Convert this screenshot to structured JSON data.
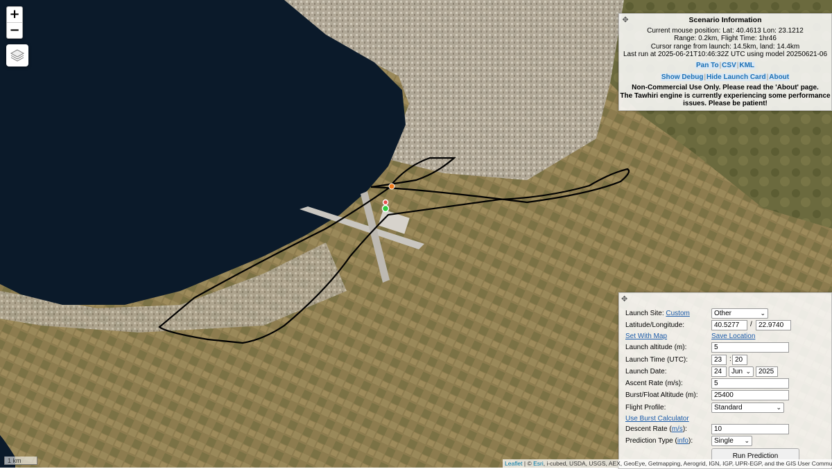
{
  "map": {
    "zoom_in": "+",
    "zoom_out": "−",
    "layers_icon": "layers-icon",
    "scale": "1 km",
    "attribution": {
      "leaflet": "Leaflet",
      "sep": " | © ",
      "esri": "Esri",
      "rest": ", i-cubed, USDA, USGS, AEX, GeoEye, Getmapping, Aerogrid, IGN, IGP, UPR-EGP, and the GIS User Community"
    },
    "colors": {
      "sea": "#0b1a2a",
      "land": "#8a7a4e",
      "urban": "#b8b0a2",
      "track": "#000000",
      "launch_marker": "#2ecc40",
      "burst_marker": "#e84a4a",
      "landing_marker": "#f07a1a"
    }
  },
  "scenario": {
    "title": "Scenario Information",
    "mouse_position": "Current mouse position: Lat: 40.4613 Lon: 23.1212",
    "range": "Range: 0.2km, Flight Time: 1hr46",
    "cursor_range": "Cursor range from launch: 14.5km, land: 14.4km",
    "last_run": "Last run at 2025-06-21T10:46:32Z UTC using model 20250621-06",
    "link_pan": "Pan To",
    "link_csv": "CSV",
    "link_kml": "KML",
    "link_debug": "Show Debug",
    "link_hide": "Hide Launch Card",
    "link_about": "About",
    "notice1": "Non-Commercial Use Only. Please read the 'About' page.",
    "notice2": "The Tawhiri engine is currently experiencing some performance",
    "notice3": "issues. Please be patient!"
  },
  "launch": {
    "site_label": "Launch Site:",
    "site_custom": "Custom",
    "site_value": "Other",
    "latlon_label": "Latitude/Longitude:",
    "lat": "40.5277",
    "lon": "22.9740",
    "slash": "/",
    "set_with_map": "Set With Map",
    "save_location": "Save Location",
    "alt_label": "Launch altitude (m):",
    "alt_value": "5",
    "time_label": "Launch Time (UTC):",
    "hour": "23",
    "colon": ":",
    "minute": "20",
    "date_label": "Launch Date:",
    "day": "24",
    "month": "Jun",
    "year": "2025",
    "ascent_label": "Ascent Rate (m/s):",
    "ascent_value": "5",
    "burst_label": "Burst/Float Altitude (m):",
    "burst_value": "25400",
    "profile_label": "Flight Profile:",
    "profile_value": "Standard",
    "burst_calc": "Use Burst Calculator",
    "descent_label_pre": "Descent Rate (",
    "descent_label_link": "m/s",
    "descent_label_post": "):",
    "descent_value": "10",
    "ptype_label_pre": "Prediction Type (",
    "ptype_label_link": "info",
    "ptype_label_post": "):",
    "ptype_value": "Single",
    "run_button": "Run Prediction"
  }
}
